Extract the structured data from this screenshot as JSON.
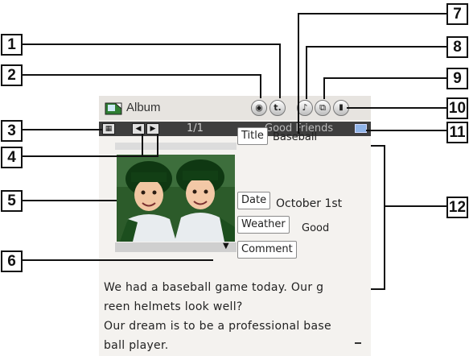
{
  "callouts": [
    "1",
    "2",
    "3",
    "4",
    "5",
    "6",
    "7",
    "8",
    "9",
    "10",
    "11",
    "12"
  ],
  "app": {
    "title": "Album",
    "app_icon": "album-icon"
  },
  "toolbar": {
    "page_indicator": "1/1",
    "album_name": "Good Friends",
    "left_icon": "thumbnail-view-icon",
    "prev_icon": "previous-page-icon",
    "next_icon": "next-page-icon",
    "right_icon": "memo-icon"
  },
  "title_buttons": [
    {
      "name": "camera-icon",
      "glyph": "◉"
    },
    {
      "name": "text-tool-icon",
      "glyph": "t."
    },
    {
      "name": "music-icon",
      "glyph": "♪"
    },
    {
      "name": "copy-icon",
      "glyph": "⧉"
    },
    {
      "name": "trash-icon",
      "glyph": "🗑"
    }
  ],
  "fields": {
    "title_label": "Title",
    "title_value": "Baseball",
    "date_label": "Date",
    "date_value": "October 1st",
    "weather_label": "Weather",
    "weather_value": "Good",
    "comment_label": "Comment"
  },
  "photo": {
    "dropdown_icon": "dropdown-arrow-icon"
  },
  "memo_lines": [
    "We had a baseball game today. Our g",
    "reen helmets look well?",
    "Our dream is to be a professional base",
    "ball player."
  ],
  "colors": {
    "toolbar_bg": "#3e3e3e",
    "screen_bg": "#f4f2ef",
    "helmet_green": "#1f5d22"
  }
}
